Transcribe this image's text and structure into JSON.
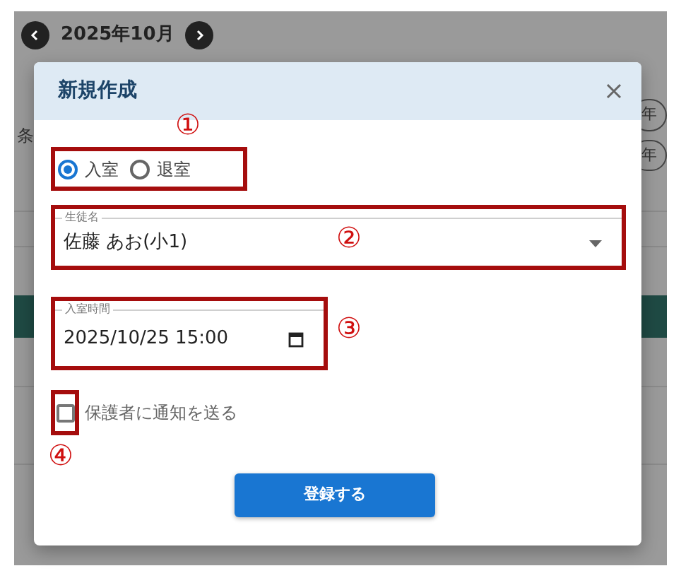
{
  "background": {
    "month": "2025年10月",
    "filter_label": "条",
    "pills": [
      "年",
      "年"
    ]
  },
  "dialog": {
    "title": "新規作成",
    "entry_types": [
      {
        "label": "入室",
        "selected": true
      },
      {
        "label": "退室",
        "selected": false
      }
    ],
    "student": {
      "label": "生徒名",
      "value": "佐藤 あお(小1)"
    },
    "time": {
      "label": "入室時間",
      "value": "2025/10/25 15:00"
    },
    "notify": {
      "label": "保護者に通知を送る",
      "checked": false
    },
    "submit": "登録する"
  },
  "annotations": [
    "①",
    "②",
    "③",
    "④"
  ]
}
